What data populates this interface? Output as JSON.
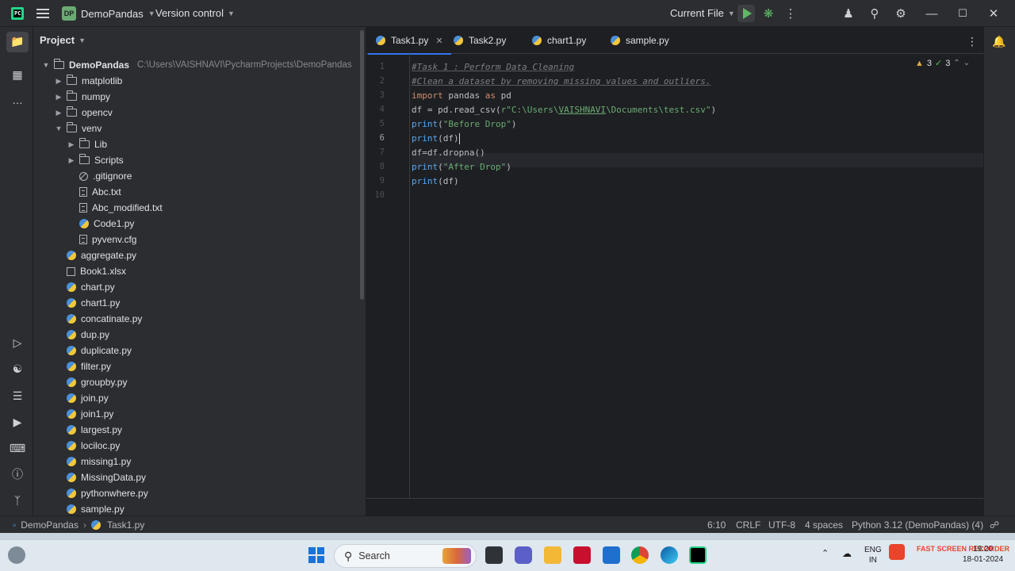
{
  "titlebar": {
    "logo_text": "PC",
    "project_badge": "DP",
    "project_name": "DemoPandas",
    "version_control": "Version control",
    "run_config": "Current File"
  },
  "project_panel": {
    "title": "Project",
    "root": {
      "name": "DemoPandas",
      "path": "C:\\Users\\VAISHNAVI\\PycharmProjects\\DemoPandas"
    },
    "items": [
      {
        "label": "matplotlib",
        "kind": "folder",
        "depth": 1,
        "expanded": false
      },
      {
        "label": "numpy",
        "kind": "folder",
        "depth": 1,
        "expanded": false
      },
      {
        "label": "opencv",
        "kind": "folder",
        "depth": 1,
        "expanded": false
      },
      {
        "label": "venv",
        "kind": "folder",
        "depth": 1,
        "expanded": true
      },
      {
        "label": "Lib",
        "kind": "folder",
        "depth": 2,
        "expanded": false
      },
      {
        "label": "Scripts",
        "kind": "folder",
        "depth": 2,
        "expanded": false
      },
      {
        "label": ".gitignore",
        "kind": "ignore",
        "depth": 2
      },
      {
        "label": "Abc.txt",
        "kind": "text",
        "depth": 2
      },
      {
        "label": "Abc_modified.txt",
        "kind": "text",
        "depth": 2
      },
      {
        "label": "Code1.py",
        "kind": "python",
        "depth": 2
      },
      {
        "label": "pyvenv.cfg",
        "kind": "text",
        "depth": 2
      },
      {
        "label": "aggregate.py",
        "kind": "python",
        "depth": 1
      },
      {
        "label": "Book1.xlsx",
        "kind": "excel",
        "depth": 1
      },
      {
        "label": "chart.py",
        "kind": "python",
        "depth": 1
      },
      {
        "label": "chart1.py",
        "kind": "python",
        "depth": 1
      },
      {
        "label": "concatinate.py",
        "kind": "python",
        "depth": 1
      },
      {
        "label": "dup.py",
        "kind": "python",
        "depth": 1
      },
      {
        "label": "duplicate.py",
        "kind": "python",
        "depth": 1
      },
      {
        "label": "filter.py",
        "kind": "python",
        "depth": 1
      },
      {
        "label": "groupby.py",
        "kind": "python",
        "depth": 1
      },
      {
        "label": "join.py",
        "kind": "python",
        "depth": 1
      },
      {
        "label": "join1.py",
        "kind": "python",
        "depth": 1
      },
      {
        "label": "largest.py",
        "kind": "python",
        "depth": 1
      },
      {
        "label": "lociloc.py",
        "kind": "python",
        "depth": 1
      },
      {
        "label": "missing1.py",
        "kind": "python",
        "depth": 1
      },
      {
        "label": "MissingData.py",
        "kind": "python",
        "depth": 1
      },
      {
        "label": "pythonwhere.py",
        "kind": "python",
        "depth": 1
      },
      {
        "label": "sample.py",
        "kind": "python",
        "depth": 1
      }
    ]
  },
  "editor": {
    "tabs": [
      {
        "label": "Task1.py",
        "active": true
      },
      {
        "label": "Task2.py",
        "active": false
      },
      {
        "label": "chart1.py",
        "active": false
      },
      {
        "label": "sample.py",
        "active": false
      }
    ],
    "line_numbers": [
      "1",
      "2",
      "3",
      "4",
      "5",
      "6",
      "7",
      "8",
      "9",
      "10"
    ],
    "current_line": "6",
    "code": {
      "l1": "#Task 1 : Perform Data Cleaning",
      "l2": "#Clean a dataset by removing missing values and outliers.",
      "l3_kw1": "import",
      "l3_mod": " pandas ",
      "l3_kw2": "as",
      "l3_alias": " pd",
      "l4_pre": "df = pd.read_csv(",
      "l4_str1": "r\"C:\\Users\\",
      "l4_str2": "VAISHNAVI",
      "l4_str3": "\\Documents\\test.csv\"",
      "l4_post": ")",
      "l5_fn": "print",
      "l5_open": "(",
      "l5_str": "\"Before Drop\"",
      "l5_close": ")",
      "l6_fn": "print",
      "l6_args": "(df)",
      "l7": "df=df.dropna()",
      "l8_fn": "print",
      "l8_open": "(",
      "l8_str": "\"After Drop\"",
      "l8_close": ")",
      "l9_fn": "print",
      "l9_args": "(df)"
    },
    "inspections": {
      "warnings": "3",
      "ok": "3"
    }
  },
  "statusbar": {
    "crumb_project": "DemoPandas",
    "crumb_file": "Task1.py",
    "position": "6:10",
    "line_sep": "CRLF",
    "encoding": "UTF-8",
    "indent": "4 spaces",
    "interpreter": "Python 3.12 (DemoPandas) (4)"
  },
  "taskbar": {
    "search_placeholder": "Search",
    "lang_top": "ENG",
    "lang_bottom": "IN",
    "clock_time": "19:20",
    "clock_date": "18-01-2024",
    "recorder": "FAST SCREEN RECORDER"
  },
  "colors": {
    "accent": "#3574f0",
    "run_green": "#5fb865",
    "string": "#6aab73",
    "keyword": "#cf8e6d",
    "function": "#56a8f5",
    "comment": "#7a7e85"
  }
}
